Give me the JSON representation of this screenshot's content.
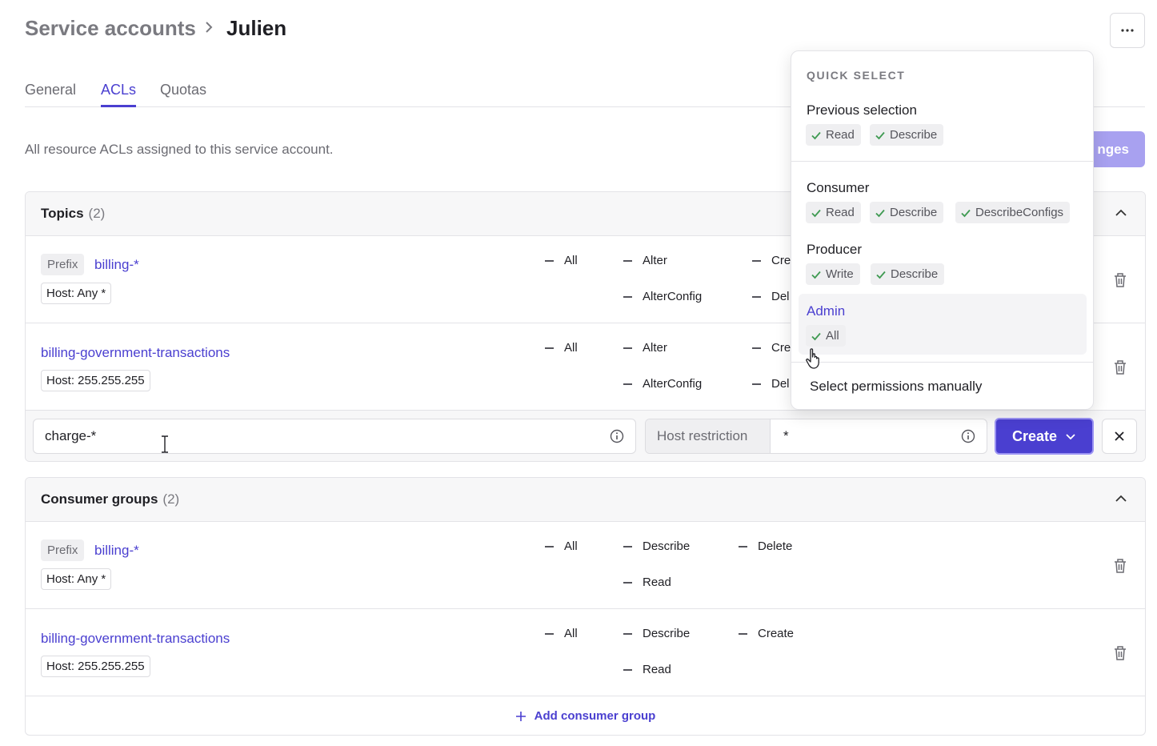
{
  "breadcrumb": {
    "parent": "Service accounts",
    "current": "Julien"
  },
  "header": {
    "more_label": "···"
  },
  "tabs": [
    {
      "label": "General",
      "active": false
    },
    {
      "label": "ACLs",
      "active": true
    },
    {
      "label": "Quotas",
      "active": false
    }
  ],
  "description": "All resource ACLs assigned to this service account.",
  "save_button_label": "nges",
  "topics": {
    "title": "Topics",
    "count": "(2)",
    "rows": [
      {
        "prefix": "Prefix",
        "name": "billing-*",
        "host": "Host: Any *",
        "permissions": [
          "All",
          "Alter",
          "AlterConfig",
          "Cre",
          "Del"
        ]
      },
      {
        "prefix": "",
        "name": "billing-government-transactions",
        "host": "Host: 255.255.255",
        "permissions": [
          "All",
          "Alter",
          "AlterConfig",
          "Cre",
          "Del"
        ]
      }
    ],
    "new_row": {
      "resource_value": "charge-*",
      "host_label": "Host restriction",
      "host_value": "*",
      "create_label": "Create"
    }
  },
  "consumer_groups": {
    "title": "Consumer groups",
    "count": "(2)",
    "rows": [
      {
        "prefix": "Prefix",
        "name": "billing-*",
        "host": "Host: Any *",
        "permissions": [
          "All",
          "Describe",
          "Read",
          "Delete"
        ]
      },
      {
        "prefix": "",
        "name": "billing-government-transactions",
        "host": "Host: 255.255.255",
        "permissions": [
          "All",
          "Describe",
          "Read",
          "Create"
        ]
      }
    ],
    "add_label": "Add consumer group"
  },
  "quick_select": {
    "heading": "QUICK SELECT",
    "groups": [
      {
        "title": "Previous selection",
        "chips": [
          "Read",
          "Describe"
        ]
      },
      {
        "title": "Consumer",
        "chips": [
          "Read",
          "Describe",
          "DescribeConfigs"
        ]
      },
      {
        "title": "Producer",
        "chips": [
          "Write",
          "Describe"
        ]
      },
      {
        "title": "Admin",
        "chips": [
          "All"
        ]
      }
    ],
    "manual_label": "Select permissions manually"
  },
  "colors": {
    "accent": "#4a3fd0",
    "disabled_button": "#a8a1f0",
    "check": "#3f9a52"
  }
}
